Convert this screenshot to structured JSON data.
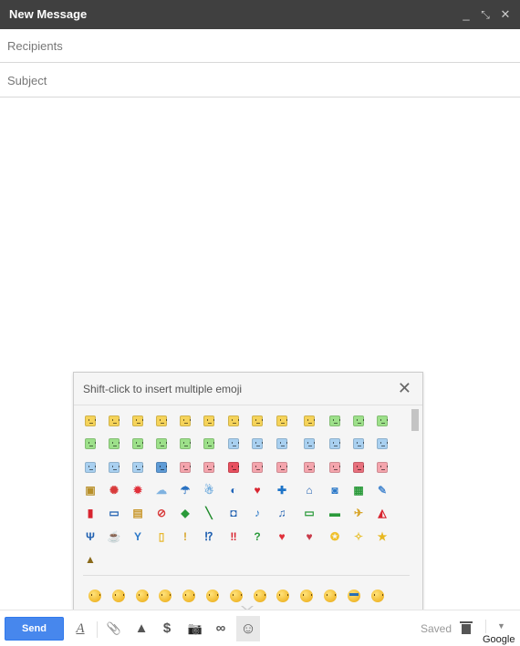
{
  "window": {
    "title": "New Message",
    "controls": {
      "minimize": "_",
      "popout": "⤡",
      "close": "✕"
    }
  },
  "fields": {
    "recipients": {
      "placeholder": "Recipients",
      "value": ""
    },
    "subject": {
      "placeholder": "Subject",
      "value": ""
    }
  },
  "emoji_picker": {
    "hint": "Shift-click to insert multiple emoji",
    "close": "✕",
    "rows": [
      [
        {
          "name": "smile",
          "kind": "face",
          "color": "#f5d35a"
        },
        {
          "name": "happy",
          "kind": "face",
          "color": "#f5d35a"
        },
        {
          "name": "wink",
          "kind": "face",
          "color": "#f5d35a"
        },
        {
          "name": "laugh",
          "kind": "face",
          "color": "#f5d35a"
        },
        {
          "name": "blush",
          "kind": "face",
          "color": "#f5d35a"
        },
        {
          "name": "content",
          "kind": "face",
          "color": "#f5d35a"
        },
        {
          "name": "grin",
          "kind": "face",
          "color": "#f5d35a"
        },
        {
          "name": "small-smile",
          "kind": "face",
          "color": "#f5d35a"
        },
        {
          "name": "kiss-wide",
          "kind": "face",
          "color": "#f5d35a"
        },
        {
          "name": "tongue",
          "kind": "face",
          "color": "#f5d35a"
        },
        {
          "name": "green-smile",
          "kind": "face",
          "color": "#9de08a"
        },
        {
          "name": "green-neutral",
          "kind": "face",
          "color": "#9de08a"
        },
        {
          "name": "green-glasses",
          "kind": "face",
          "color": "#9de08a"
        }
      ],
      [
        {
          "name": "green-sick",
          "kind": "face",
          "color": "#9de08a"
        },
        {
          "name": "green-sad",
          "kind": "face",
          "color": "#9de08a"
        },
        {
          "name": "green-smirk",
          "kind": "face",
          "color": "#9de08a"
        },
        {
          "name": "green-unamused",
          "kind": "face",
          "color": "#9de08a"
        },
        {
          "name": "green-skeptic",
          "kind": "face",
          "color": "#9de08a"
        },
        {
          "name": "green-dizzy",
          "kind": "face",
          "color": "#9de08a"
        },
        {
          "name": "blue-sunglasses",
          "kind": "face",
          "color": "#a9d0f0"
        },
        {
          "name": "blue-sad",
          "kind": "face",
          "color": "#a9d0f0"
        },
        {
          "name": "blue-confused",
          "kind": "face",
          "color": "#a9d0f0"
        },
        {
          "name": "blue-sweat",
          "kind": "face",
          "color": "#a9d0f0"
        },
        {
          "name": "blue-scream",
          "kind": "face",
          "color": "#a9d0f0"
        },
        {
          "name": "blue-worried",
          "kind": "face",
          "color": "#a9d0f0"
        },
        {
          "name": "blue-frown",
          "kind": "face",
          "color": "#a9d0f0"
        }
      ],
      [
        {
          "name": "blue-cold",
          "kind": "face",
          "color": "#a9d0f0"
        },
        {
          "name": "blue-tired",
          "kind": "face",
          "color": "#a9d0f0"
        },
        {
          "name": "blue-cry",
          "kind": "face",
          "color": "#a9d0f0"
        },
        {
          "name": "blue-fear",
          "kind": "face",
          "color": "#5e9bd6"
        },
        {
          "name": "red-tongue",
          "kind": "face",
          "color": "#f4a5ad"
        },
        {
          "name": "red-laugh",
          "kind": "face",
          "color": "#f4a5ad"
        },
        {
          "name": "red-love",
          "kind": "face",
          "color": "#e8505f"
        },
        {
          "name": "red-pout",
          "kind": "face",
          "color": "#f4a5ad"
        },
        {
          "name": "red-angry",
          "kind": "face",
          "color": "#f4a5ad"
        },
        {
          "name": "red-annoyed",
          "kind": "face",
          "color": "#f4a5ad"
        },
        {
          "name": "red-mad",
          "kind": "face",
          "color": "#f4a5ad"
        },
        {
          "name": "devil",
          "kind": "face",
          "color": "#e8707d"
        },
        {
          "name": "pig",
          "kind": "face",
          "color": "#f4a5ad"
        }
      ],
      [
        {
          "name": "robot",
          "kind": "glyph",
          "glyph": "▣",
          "color": "#b8902a"
        },
        {
          "name": "crab",
          "kind": "glyph",
          "glyph": "✺",
          "color": "#d83a3a"
        },
        {
          "name": "sun",
          "kind": "glyph",
          "glyph": "✹",
          "color": "#e0303a"
        },
        {
          "name": "cloud",
          "kind": "glyph",
          "glyph": "☁",
          "color": "#7fb2e0"
        },
        {
          "name": "umbrella",
          "kind": "glyph",
          "glyph": "☂",
          "color": "#2a72c2"
        },
        {
          "name": "snowman",
          "kind": "glyph",
          "glyph": "☃",
          "color": "#6aa8dc"
        },
        {
          "name": "moon",
          "kind": "glyph",
          "glyph": "◐",
          "color": "#1e63b8"
        },
        {
          "name": "tulip",
          "kind": "glyph",
          "glyph": "♥",
          "color": "#d8242f"
        },
        {
          "name": "clover",
          "kind": "glyph",
          "glyph": "✚",
          "color": "#1e74c8"
        },
        {
          "name": "house",
          "kind": "glyph",
          "glyph": "⌂",
          "color": "#1e5fb0"
        },
        {
          "name": "camera",
          "kind": "glyph",
          "glyph": "◙",
          "color": "#2a78c8"
        },
        {
          "name": "gift",
          "kind": "glyph",
          "glyph": "▦",
          "color": "#2a9a3a"
        },
        {
          "name": "balloon",
          "kind": "glyph",
          "glyph": "✎",
          "color": "#4a8ad0"
        }
      ],
      [
        {
          "name": "phone",
          "kind": "glyph",
          "glyph": "▮",
          "color": "#d8242f"
        },
        {
          "name": "computer",
          "kind": "glyph",
          "glyph": "▭",
          "color": "#1e5fb0"
        },
        {
          "name": "briefcase",
          "kind": "glyph",
          "glyph": "▤",
          "color": "#c8962a"
        },
        {
          "name": "baseball",
          "kind": "glyph",
          "glyph": "⊘",
          "color": "#d83a3a"
        },
        {
          "name": "car",
          "kind": "glyph",
          "glyph": "◆",
          "color": "#2a9a3a"
        },
        {
          "name": "microphone",
          "kind": "glyph",
          "glyph": "╲",
          "color": "#1e8a2a"
        },
        {
          "name": "video-camera",
          "kind": "glyph",
          "glyph": "◘",
          "color": "#1e5fb0"
        },
        {
          "name": "music-note",
          "kind": "glyph",
          "glyph": "♪",
          "color": "#2a78c8"
        },
        {
          "name": "music-notes",
          "kind": "glyph",
          "glyph": "♫",
          "color": "#1e5fb0"
        },
        {
          "name": "tv",
          "kind": "glyph",
          "glyph": "▭",
          "color": "#2a9a3a"
        },
        {
          "name": "radio",
          "kind": "glyph",
          "glyph": "▬",
          "color": "#2a9a3a"
        },
        {
          "name": "bird",
          "kind": "glyph",
          "glyph": "✈",
          "color": "#d8a52a"
        },
        {
          "name": "cake",
          "kind": "glyph",
          "glyph": "◭",
          "color": "#d8242f"
        }
      ],
      [
        {
          "name": "fork-knife",
          "kind": "glyph",
          "glyph": "Ψ",
          "color": "#1e5fb0"
        },
        {
          "name": "coffee",
          "kind": "glyph",
          "glyph": "☕",
          "color": "#d8a52a"
        },
        {
          "name": "cocktail",
          "kind": "glyph",
          "glyph": "Y",
          "color": "#2a78c8"
        },
        {
          "name": "beer",
          "kind": "glyph",
          "glyph": "▯",
          "color": "#e8b830"
        },
        {
          "name": "exclamation",
          "kind": "glyph",
          "glyph": "!",
          "color": "#d8a52a"
        },
        {
          "name": "interrobang",
          "kind": "glyph",
          "glyph": "⁉",
          "color": "#1e5fb0"
        },
        {
          "name": "double-exclamation",
          "kind": "glyph",
          "glyph": "‼",
          "color": "#d8242f"
        },
        {
          "name": "question",
          "kind": "glyph",
          "glyph": "?",
          "color": "#2a9a3a"
        },
        {
          "name": "heart",
          "kind": "glyph",
          "glyph": "♥",
          "color": "#e0303a"
        },
        {
          "name": "broken-heart",
          "kind": "glyph",
          "glyph": "♥",
          "color": "#c83a4a"
        },
        {
          "name": "light-bulb",
          "kind": "glyph",
          "glyph": "✪",
          "color": "#f0c02a"
        },
        {
          "name": "sparkles",
          "kind": "glyph",
          "glyph": "✧",
          "color": "#e8c030"
        },
        {
          "name": "star",
          "kind": "glyph",
          "glyph": "★",
          "color": "#e8b820"
        }
      ],
      [
        {
          "name": "poop",
          "kind": "glyph",
          "glyph": "▲",
          "color": "#8a6a1a"
        }
      ]
    ],
    "recent": [
      {
        "name": "recent-smile"
      },
      {
        "name": "recent-wink"
      },
      {
        "name": "recent-smirk"
      },
      {
        "name": "recent-grin"
      },
      {
        "name": "recent-happy"
      },
      {
        "name": "recent-blush"
      },
      {
        "name": "recent-surprised"
      },
      {
        "name": "recent-laugh"
      },
      {
        "name": "recent-content"
      },
      {
        "name": "recent-thinking"
      },
      {
        "name": "recent-relieved"
      },
      {
        "name": "recent-cool"
      },
      {
        "name": "recent-neutral"
      }
    ]
  },
  "toolbar": {
    "send_label": "Send",
    "format_icon": "A",
    "attach_icon": "📎",
    "drive_icon": "▲",
    "money_icon": "$",
    "photo_icon": "📷",
    "link_icon": "∞",
    "emoji_icon": "☺",
    "saved_label": "Saved",
    "more_icon": "▼"
  },
  "watermark": "Google"
}
